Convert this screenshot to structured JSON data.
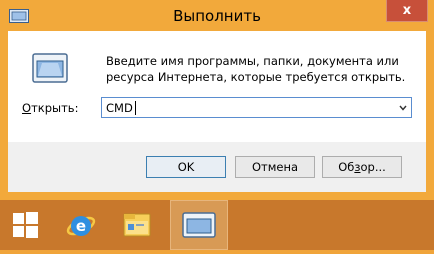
{
  "window": {
    "title": "Выполнить",
    "close_label": "x"
  },
  "content": {
    "description": "Введите имя программы, папки, документа или ресурса Интернета, которые требуется открыть.",
    "open_label_underlined": "О",
    "open_label_rest": "ткрыть:",
    "combo_value": "CMD"
  },
  "buttons": {
    "ok": "OK",
    "cancel": "Отмена",
    "browse_prefix": "Об",
    "browse_underlined": "з",
    "browse_suffix": "ор..."
  },
  "taskbar": {
    "items": [
      "start-icon",
      "internet-explorer-icon",
      "file-explorer-icon",
      "run-icon"
    ]
  },
  "colors": {
    "frame": "#f2a93b",
    "taskbar": "#c8782c",
    "close": "#c7503a"
  }
}
